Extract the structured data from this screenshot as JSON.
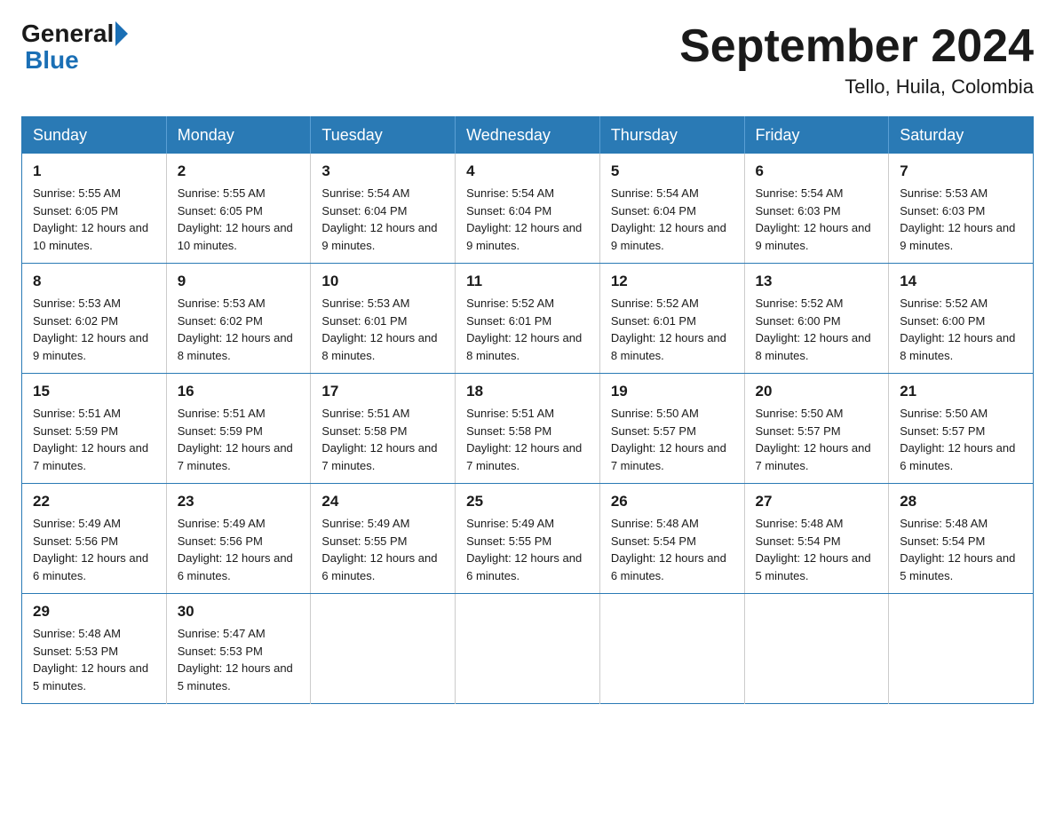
{
  "header": {
    "logo_general": "General",
    "logo_blue": "Blue",
    "month_title": "September 2024",
    "location": "Tello, Huila, Colombia"
  },
  "days_of_week": [
    "Sunday",
    "Monday",
    "Tuesday",
    "Wednesday",
    "Thursday",
    "Friday",
    "Saturday"
  ],
  "weeks": [
    [
      {
        "day": "1",
        "sunrise": "5:55 AM",
        "sunset": "6:05 PM",
        "daylight": "12 hours and 10 minutes."
      },
      {
        "day": "2",
        "sunrise": "5:55 AM",
        "sunset": "6:05 PM",
        "daylight": "12 hours and 10 minutes."
      },
      {
        "day": "3",
        "sunrise": "5:54 AM",
        "sunset": "6:04 PM",
        "daylight": "12 hours and 9 minutes."
      },
      {
        "day": "4",
        "sunrise": "5:54 AM",
        "sunset": "6:04 PM",
        "daylight": "12 hours and 9 minutes."
      },
      {
        "day": "5",
        "sunrise": "5:54 AM",
        "sunset": "6:04 PM",
        "daylight": "12 hours and 9 minutes."
      },
      {
        "day": "6",
        "sunrise": "5:54 AM",
        "sunset": "6:03 PM",
        "daylight": "12 hours and 9 minutes."
      },
      {
        "day": "7",
        "sunrise": "5:53 AM",
        "sunset": "6:03 PM",
        "daylight": "12 hours and 9 minutes."
      }
    ],
    [
      {
        "day": "8",
        "sunrise": "5:53 AM",
        "sunset": "6:02 PM",
        "daylight": "12 hours and 9 minutes."
      },
      {
        "day": "9",
        "sunrise": "5:53 AM",
        "sunset": "6:02 PM",
        "daylight": "12 hours and 8 minutes."
      },
      {
        "day": "10",
        "sunrise": "5:53 AM",
        "sunset": "6:01 PM",
        "daylight": "12 hours and 8 minutes."
      },
      {
        "day": "11",
        "sunrise": "5:52 AM",
        "sunset": "6:01 PM",
        "daylight": "12 hours and 8 minutes."
      },
      {
        "day": "12",
        "sunrise": "5:52 AM",
        "sunset": "6:01 PM",
        "daylight": "12 hours and 8 minutes."
      },
      {
        "day": "13",
        "sunrise": "5:52 AM",
        "sunset": "6:00 PM",
        "daylight": "12 hours and 8 minutes."
      },
      {
        "day": "14",
        "sunrise": "5:52 AM",
        "sunset": "6:00 PM",
        "daylight": "12 hours and 8 minutes."
      }
    ],
    [
      {
        "day": "15",
        "sunrise": "5:51 AM",
        "sunset": "5:59 PM",
        "daylight": "12 hours and 7 minutes."
      },
      {
        "day": "16",
        "sunrise": "5:51 AM",
        "sunset": "5:59 PM",
        "daylight": "12 hours and 7 minutes."
      },
      {
        "day": "17",
        "sunrise": "5:51 AM",
        "sunset": "5:58 PM",
        "daylight": "12 hours and 7 minutes."
      },
      {
        "day": "18",
        "sunrise": "5:51 AM",
        "sunset": "5:58 PM",
        "daylight": "12 hours and 7 minutes."
      },
      {
        "day": "19",
        "sunrise": "5:50 AM",
        "sunset": "5:57 PM",
        "daylight": "12 hours and 7 minutes."
      },
      {
        "day": "20",
        "sunrise": "5:50 AM",
        "sunset": "5:57 PM",
        "daylight": "12 hours and 7 minutes."
      },
      {
        "day": "21",
        "sunrise": "5:50 AM",
        "sunset": "5:57 PM",
        "daylight": "12 hours and 6 minutes."
      }
    ],
    [
      {
        "day": "22",
        "sunrise": "5:49 AM",
        "sunset": "5:56 PM",
        "daylight": "12 hours and 6 minutes."
      },
      {
        "day": "23",
        "sunrise": "5:49 AM",
        "sunset": "5:56 PM",
        "daylight": "12 hours and 6 minutes."
      },
      {
        "day": "24",
        "sunrise": "5:49 AM",
        "sunset": "5:55 PM",
        "daylight": "12 hours and 6 minutes."
      },
      {
        "day": "25",
        "sunrise": "5:49 AM",
        "sunset": "5:55 PM",
        "daylight": "12 hours and 6 minutes."
      },
      {
        "day": "26",
        "sunrise": "5:48 AM",
        "sunset": "5:54 PM",
        "daylight": "12 hours and 6 minutes."
      },
      {
        "day": "27",
        "sunrise": "5:48 AM",
        "sunset": "5:54 PM",
        "daylight": "12 hours and 5 minutes."
      },
      {
        "day": "28",
        "sunrise": "5:48 AM",
        "sunset": "5:54 PM",
        "daylight": "12 hours and 5 minutes."
      }
    ],
    [
      {
        "day": "29",
        "sunrise": "5:48 AM",
        "sunset": "5:53 PM",
        "daylight": "12 hours and 5 minutes."
      },
      {
        "day": "30",
        "sunrise": "5:47 AM",
        "sunset": "5:53 PM",
        "daylight": "12 hours and 5 minutes."
      },
      null,
      null,
      null,
      null,
      null
    ]
  ]
}
